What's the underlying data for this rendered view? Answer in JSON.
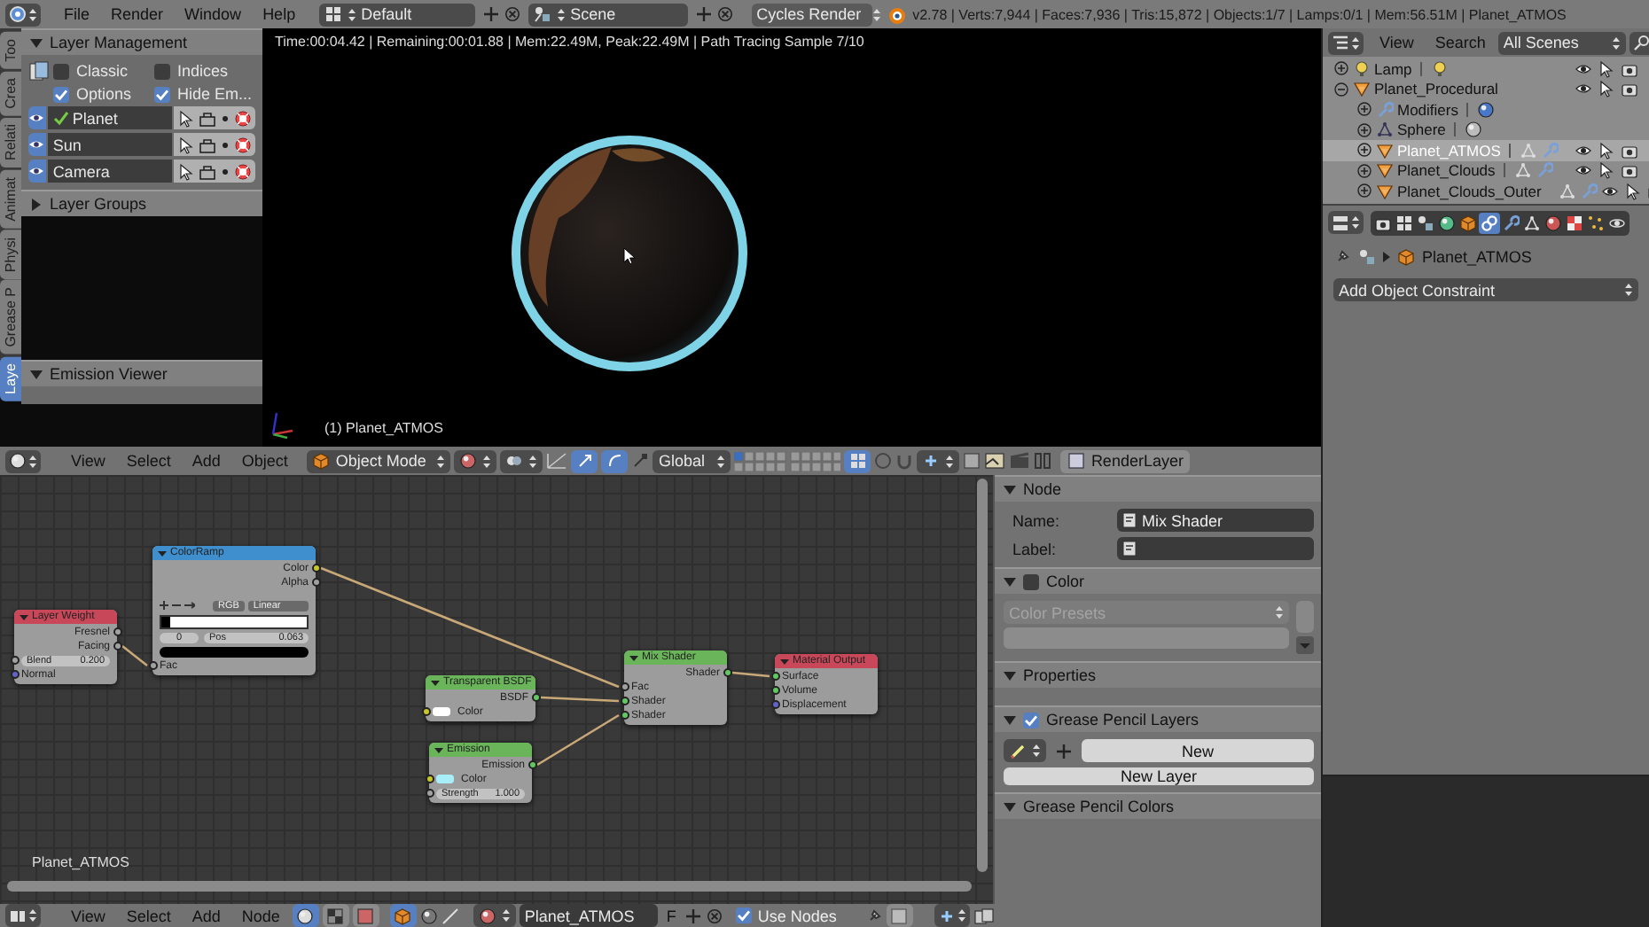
{
  "top_bar": {
    "menus": [
      "File",
      "Render",
      "Window",
      "Help"
    ],
    "screen_layout": "Default",
    "scene": "Scene",
    "render_engine": "Cycles Render",
    "stats": "v2.78 | Verts:7,944 | Faces:7,936 | Tris:15,872 | Objects:1/7 | Lamps:0/1 | Mem:56.51M | Planet_ATMOS"
  },
  "tool_tabs": [
    {
      "label": "Too",
      "selected": false
    },
    {
      "label": "Crea",
      "selected": false
    },
    {
      "label": "Relati",
      "selected": false
    },
    {
      "label": "Animat",
      "selected": false
    },
    {
      "label": "Physi",
      "selected": false
    },
    {
      "label": "Grease P",
      "selected": false
    },
    {
      "label": "Laye",
      "selected": true
    }
  ],
  "layer_management": {
    "title": "Layer Management",
    "expanded": true,
    "options": [
      {
        "label": "Classic",
        "checked": false
      },
      {
        "label": "Indices",
        "checked": false
      },
      {
        "label": "Options",
        "checked": true
      },
      {
        "label": "Hide Em...",
        "checked": true
      }
    ],
    "layers": [
      {
        "name": "Planet",
        "active": true
      },
      {
        "name": "Sun",
        "active": false
      },
      {
        "name": "Camera",
        "active": false
      }
    ]
  },
  "layer_groups": {
    "title": "Layer Groups",
    "expanded": false
  },
  "emission_viewer": {
    "title": "Emission Viewer",
    "expanded": true
  },
  "viewport": {
    "render_info": "Time:00:04.42 | Remaining:00:01.88 | Mem:22.49M, Peak:22.49M | Path Tracing Sample 7/10",
    "object_label": "(1) Planet_ATMOS"
  },
  "viewport_header": {
    "menus": [
      "View",
      "Select",
      "Add",
      "Object"
    ],
    "mode": "Object Mode",
    "orientation": "Global",
    "render_layer": "RenderLayer"
  },
  "node_editor": {
    "material_label": "Planet_ATMOS",
    "nodes": [
      {
        "kind": "input",
        "title": "Layer Weight",
        "rows": [
          {
            "kind": "output",
            "label": "Fresnel",
            "socket": {
              "color": "#a1a1a1"
            }
          },
          {
            "kind": "output",
            "label": "Facing",
            "socket": {
              "color": "#a1a1a1"
            }
          },
          {
            "kind": "value",
            "label": "Blend",
            "value": "0.200",
            "socket": {
              "color": "#a1a1a1"
            }
          },
          {
            "kind": "input",
            "label": "Normal",
            "socket": {
              "color": "#6363c7"
            }
          }
        ]
      },
      {
        "kind": "converter",
        "title": "ColorRamp",
        "rows": [
          {
            "kind": "output",
            "label": "Color",
            "socket": {
              "color": "#c7c729"
            }
          },
          {
            "kind": "output",
            "label": "Alpha",
            "socket": {
              "color": "#a1a1a1"
            }
          },
          {
            "kind": "ramp_mode",
            "mode": "RGB",
            "interpolation": "Linear"
          },
          {
            "kind": "ramp_bar"
          },
          {
            "kind": "ramp_stop",
            "index": "0",
            "label": "Pos",
            "value": "0.063"
          },
          {
            "kind": "ramp_color",
            "color": "#000000"
          },
          {
            "kind": "input",
            "label": "Fac",
            "socket": {
              "color": "#a1a1a1"
            }
          }
        ]
      },
      {
        "kind": "shader",
        "title": "Transparent BSDF",
        "rows": [
          {
            "kind": "output",
            "label": "BSDF",
            "socket": {
              "color": "#63c763"
            }
          },
          {
            "kind": "color",
            "label": "Color",
            "color": "#ffffff",
            "socket": {
              "color": "#c7c729"
            }
          }
        ]
      },
      {
        "kind": "shader",
        "title": "Emission",
        "rows": [
          {
            "kind": "output",
            "label": "Emission",
            "socket": {
              "color": "#63c763"
            }
          },
          {
            "kind": "color",
            "label": "Color",
            "color": "#a8eef8",
            "socket": {
              "color": "#c7c729"
            }
          },
          {
            "kind": "value",
            "label": "Strength",
            "value": "1.000",
            "socket": {
              "color": "#a1a1a1"
            }
          }
        ]
      },
      {
        "kind": "shader",
        "title": "Mix Shader",
        "rows": [
          {
            "kind": "output",
            "label": "Shader",
            "socket": {
              "color": "#63c763"
            }
          },
          {
            "kind": "input",
            "label": "Fac",
            "socket": {
              "color": "#a1a1a1"
            }
          },
          {
            "kind": "input",
            "label": "Shader",
            "socket": {
              "color": "#63c763"
            }
          },
          {
            "kind": "input",
            "label": "Shader",
            "socket": {
              "color": "#63c763"
            }
          }
        ]
      },
      {
        "kind": "output",
        "title": "Material Output",
        "rows": [
          {
            "kind": "input",
            "label": "Surface",
            "socket": {
              "color": "#63c763"
            }
          },
          {
            "kind": "input",
            "label": "Volume",
            "socket": {
              "color": "#63c763"
            }
          },
          {
            "kind": "input",
            "label": "Displacement",
            "socket": {
              "color": "#6363c7"
            }
          }
        ]
      }
    ]
  },
  "node_sidebar": {
    "node_panel": {
      "title": "Node",
      "expanded": true,
      "name_label": "Name:",
      "name_value": "Mix Shader",
      "label_label": "Label:"
    },
    "color_panel": {
      "title": "Color",
      "expanded": true,
      "enabled": false,
      "presets": "Color Presets",
      "presets_disabled": true
    },
    "properties_panel": {
      "title": "Properties",
      "expanded": true
    },
    "grease_pencil_layers": {
      "title": "Grease Pencil Layers",
      "expanded": true,
      "enabled": true,
      "new_button": "New",
      "new_layer_button": "New Layer"
    },
    "grease_pencil_colors": {
      "title": "Grease Pencil Colors",
      "expanded": true
    }
  },
  "node_header": {
    "menus": [
      "View",
      "Select",
      "Add",
      "Node"
    ],
    "material": "Planet_ATMOS",
    "fake_user": "F",
    "use_nodes": {
      "label": "Use Nodes",
      "checked": true
    }
  },
  "outliner": {
    "menus": [
      "View",
      "Search"
    ],
    "display_mode": "All Scenes",
    "tree": [
      {
        "name": "Lamp",
        "kind": "lamp",
        "expanded": false,
        "selected": false
      },
      {
        "name": "Planet_Procedural",
        "kind": "object",
        "expanded": true,
        "selected": false,
        "children": [
          {
            "name": "Modifiers",
            "kind": "modifiers",
            "expanded": false,
            "selected": false
          },
          {
            "name": "Sphere",
            "kind": "mesh_data",
            "expanded": false,
            "selected": false
          },
          {
            "name": "Planet_ATMOS",
            "kind": "object",
            "expanded": false,
            "selected": true
          },
          {
            "name": "Planet_Clouds",
            "kind": "object",
            "expanded": false,
            "selected": false
          },
          {
            "name": "Planet_Clouds_Outer",
            "kind": "object",
            "expanded": false,
            "selected": false
          }
        ]
      }
    ]
  },
  "properties": {
    "tabs": [
      {
        "kind": "render",
        "selected": false
      },
      {
        "kind": "render_layers",
        "selected": false
      },
      {
        "kind": "scene",
        "selected": false
      },
      {
        "kind": "world",
        "selected": false
      },
      {
        "kind": "object",
        "selected": false
      },
      {
        "kind": "constraints",
        "selected": true
      },
      {
        "kind": "modifiers",
        "selected": false
      },
      {
        "kind": "data",
        "selected": false
      },
      {
        "kind": "material",
        "selected": false
      },
      {
        "kind": "texture",
        "selected": false
      },
      {
        "kind": "particles",
        "selected": false
      },
      {
        "kind": "physics",
        "selected": false
      }
    ],
    "object": "Planet_ATMOS",
    "constraint_menu": "Add Object Constraint"
  }
}
